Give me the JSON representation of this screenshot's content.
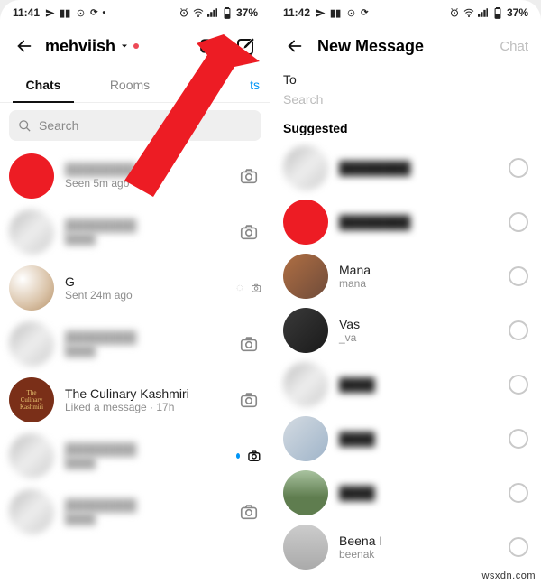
{
  "status": {
    "time_left": "11:41",
    "time_right": "11:42",
    "battery": "37%"
  },
  "left": {
    "username": "mehviish",
    "tabs": {
      "chats": "Chats",
      "rooms": "Rooms",
      "requests": "ts"
    },
    "search_placeholder": "Search",
    "chats": [
      {
        "name": "████████",
        "sub": "Seen 5m ago"
      },
      {
        "name": "████████",
        "sub": "████"
      },
      {
        "name": "G",
        "sub": "Sent 24m ago"
      },
      {
        "name": "████████",
        "sub": "████"
      },
      {
        "name": "The Culinary Kashmiri",
        "sub": "Liked a message · 17h"
      },
      {
        "name": "████████",
        "sub": "████"
      },
      {
        "name": "████████",
        "sub": "████"
      }
    ]
  },
  "right": {
    "title": "New Message",
    "action": "Chat",
    "to_label": "To",
    "search_placeholder": "Search",
    "suggested_label": "Suggested",
    "items": [
      {
        "name": "████████",
        "sub": ""
      },
      {
        "name": "████████",
        "sub": ""
      },
      {
        "name": "Mana",
        "sub": "mana"
      },
      {
        "name": "Vas",
        "sub": "_va"
      },
      {
        "name": "████",
        "sub": "████"
      },
      {
        "name": "████",
        "sub": "████"
      },
      {
        "name": "████",
        "sub": "████"
      },
      {
        "name": "Beena I",
        "sub": "beenak"
      }
    ]
  },
  "watermark": "wsxdn.com"
}
